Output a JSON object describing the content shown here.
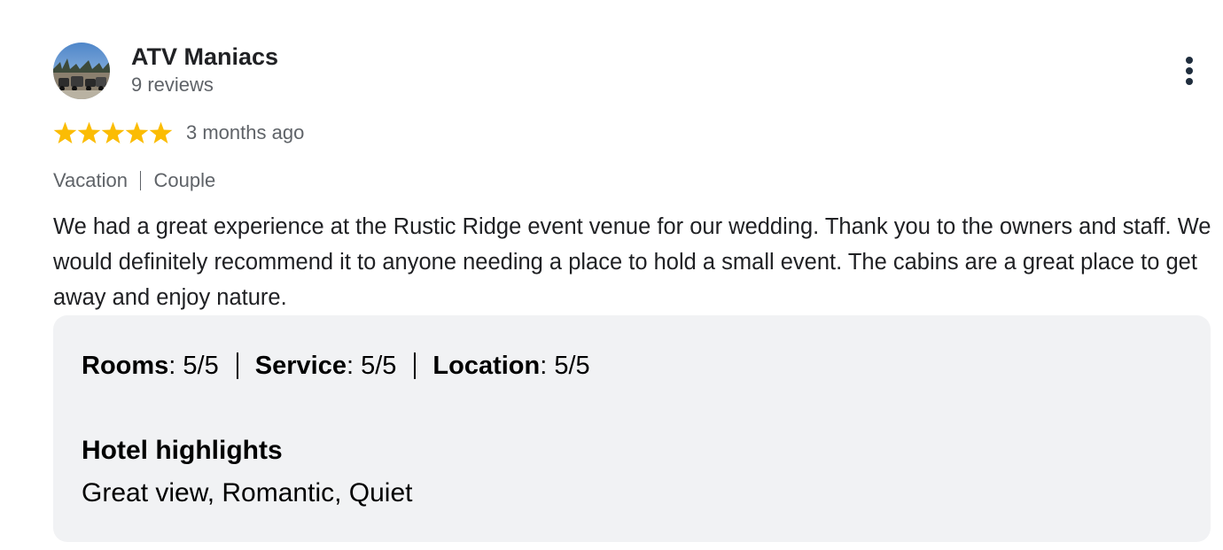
{
  "reviewer": {
    "name": "ATV Maniacs",
    "review_count": "9 reviews",
    "avatar": "profile-photo"
  },
  "rating": {
    "stars": 5,
    "max_stars": 5,
    "star_color": "#fbbc04",
    "date": "3 months ago"
  },
  "trip": {
    "tags": [
      "Vacation",
      "Couple"
    ]
  },
  "review_text": "We had a great experience at the Rustic Ridge event venue for our wedding. Thank you to the owners and staff. We would definitely recommend it to anyone needing a place to hold a small event. The cabins are a great place to get away and enjoy nature.",
  "sub_ratings": [
    {
      "label": "Rooms",
      "value": "5/5"
    },
    {
      "label": "Service",
      "value": "5/5"
    },
    {
      "label": "Location",
      "value": "5/5"
    }
  ],
  "highlights": {
    "title": "Hotel highlights",
    "text": "Great view, Romantic, Quiet"
  },
  "menu": {
    "icon": "more-vertical-icon"
  },
  "colors": {
    "text_primary": "#202124",
    "text_secondary": "#5f6368",
    "panel_background": "#f1f2f4",
    "menu_icon": "#1f2d3d"
  }
}
